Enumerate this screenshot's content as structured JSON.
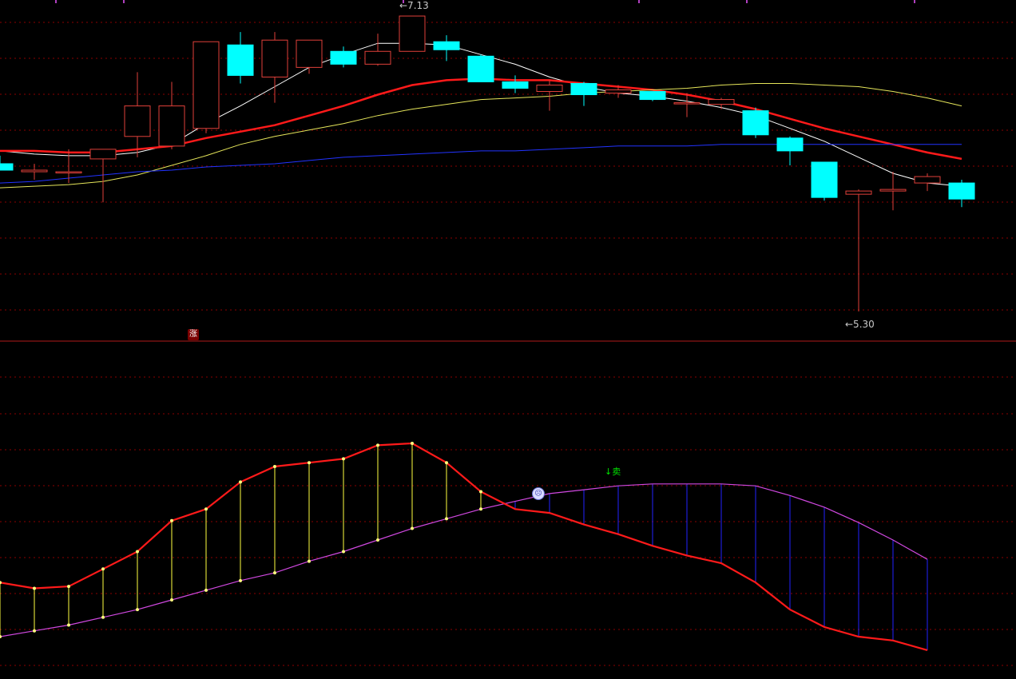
{
  "annotations": {
    "high_label": "←7.13",
    "low_label": "←5.30",
    "rise_badge": "涨",
    "sell_label": "↓卖",
    "face_icon": "face-icon"
  },
  "colors": {
    "background": "#000000",
    "grid": "#8b0000",
    "up_candle": "#e0403a",
    "down_candle": "#00ffff",
    "ma_white": "#ffffff",
    "ma_red": "#ff1a1a",
    "ma_yellow": "#e6e65a",
    "ma_blue": "#2233ff",
    "osc_fast": "#ff1a1a",
    "osc_slow": "#d048e0",
    "hist_pos": "#ffff40",
    "hist_neg": "#2222ff"
  },
  "chart_data": [
    {
      "type": "candlestick",
      "price_range": [
        5.15,
        7.2
      ],
      "grid": true,
      "candles": [
        {
          "o": 6.22,
          "h": 6.27,
          "l": 6.18,
          "c": 6.18
        },
        {
          "o": 6.17,
          "h": 6.22,
          "l": 6.12,
          "c": 6.18
        },
        {
          "o": 6.17,
          "h": 6.31,
          "l": 6.1,
          "c": 6.17
        },
        {
          "o": 6.25,
          "h": 6.31,
          "l": 5.98,
          "c": 6.31
        },
        {
          "o": 6.39,
          "h": 6.79,
          "l": 6.26,
          "c": 6.58
        },
        {
          "o": 6.33,
          "h": 6.73,
          "l": 6.31,
          "c": 6.58
        },
        {
          "o": 6.44,
          "h": 6.98,
          "l": 6.41,
          "c": 6.98
        },
        {
          "o": 6.96,
          "h": 7.04,
          "l": 6.72,
          "c": 6.77
        },
        {
          "o": 6.76,
          "h": 7.04,
          "l": 6.6,
          "c": 6.99
        },
        {
          "o": 6.82,
          "h": 6.98,
          "l": 6.78,
          "c": 6.99
        },
        {
          "o": 6.92,
          "h": 6.95,
          "l": 6.82,
          "c": 6.84
        },
        {
          "o": 6.84,
          "h": 7.03,
          "l": 6.83,
          "c": 6.92
        },
        {
          "o": 6.92,
          "h": 7.13,
          "l": 6.92,
          "c": 7.14
        },
        {
          "o": 6.98,
          "h": 7.02,
          "l": 6.86,
          "c": 6.93
        },
        {
          "o": 6.89,
          "h": 6.9,
          "l": 6.73,
          "c": 6.73
        },
        {
          "o": 6.73,
          "h": 6.77,
          "l": 6.66,
          "c": 6.69
        },
        {
          "o": 6.67,
          "h": 6.74,
          "l": 6.55,
          "c": 6.71
        },
        {
          "o": 6.72,
          "h": 6.73,
          "l": 6.58,
          "c": 6.65
        },
        {
          "o": 6.66,
          "h": 6.71,
          "l": 6.63,
          "c": 6.68
        },
        {
          "o": 6.67,
          "h": 6.67,
          "l": 6.61,
          "c": 6.62
        },
        {
          "o": 6.6,
          "h": 6.66,
          "l": 6.51,
          "c": 6.6
        },
        {
          "o": 6.59,
          "h": 6.63,
          "l": 6.56,
          "c": 6.62
        },
        {
          "o": 6.55,
          "h": 6.57,
          "l": 6.38,
          "c": 6.4
        },
        {
          "o": 6.38,
          "h": 6.39,
          "l": 6.21,
          "c": 6.3
        },
        {
          "o": 6.23,
          "h": 6.23,
          "l": 5.99,
          "c": 6.01
        },
        {
          "o": 6.03,
          "h": 6.06,
          "l": 5.3,
          "c": 6.05
        },
        {
          "o": 6.05,
          "h": 6.17,
          "l": 5.93,
          "c": 6.06
        },
        {
          "o": 6.1,
          "h": 6.16,
          "l": 6.05,
          "c": 6.14
        },
        {
          "o": 6.1,
          "h": 6.12,
          "l": 5.95,
          "c": 6.0
        }
      ],
      "moving_averages": [
        {
          "color": "white",
          "values": [
            6.3,
            6.28,
            6.27,
            6.27,
            6.29,
            6.34,
            6.47,
            6.58,
            6.7,
            6.82,
            6.9,
            6.97,
            6.97,
            6.96,
            6.9,
            6.84,
            6.76,
            6.7,
            6.66,
            6.64,
            6.61,
            6.57,
            6.52,
            6.44,
            6.36,
            6.26,
            6.16,
            6.1,
            6.08
          ]
        },
        {
          "color": "red",
          "values": [
            6.3,
            6.3,
            6.29,
            6.29,
            6.31,
            6.33,
            6.38,
            6.42,
            6.46,
            6.52,
            6.58,
            6.65,
            6.71,
            6.74,
            6.75,
            6.74,
            6.74,
            6.72,
            6.7,
            6.68,
            6.65,
            6.61,
            6.56,
            6.5,
            6.44,
            6.39,
            6.34,
            6.29,
            6.25
          ]
        },
        {
          "color": "yellow",
          "values": [
            6.07,
            6.08,
            6.09,
            6.11,
            6.15,
            6.21,
            6.27,
            6.34,
            6.39,
            6.43,
            6.47,
            6.52,
            6.56,
            6.59,
            6.62,
            6.63,
            6.64,
            6.66,
            6.67,
            6.68,
            6.69,
            6.71,
            6.72,
            6.72,
            6.71,
            6.7,
            6.67,
            6.63,
            6.58
          ]
        },
        {
          "color": "blue",
          "values": [
            6.1,
            6.11,
            6.13,
            6.15,
            6.17,
            6.18,
            6.2,
            6.21,
            6.22,
            6.24,
            6.26,
            6.27,
            6.28,
            6.29,
            6.3,
            6.3,
            6.31,
            6.32,
            6.33,
            6.33,
            6.33,
            6.34,
            6.34,
            6.34,
            6.34,
            6.34,
            6.34,
            6.34,
            6.34
          ]
        }
      ]
    },
    {
      "type": "line",
      "value_range": [
        0,
        100
      ],
      "grid": true,
      "series": [
        {
          "values": [
            28,
            25,
            26,
            35,
            44,
            60,
            66,
            80,
            88,
            90,
            92,
            99,
            100,
            90,
            75,
            66,
            64,
            58,
            53,
            47,
            42,
            38,
            28,
            14,
            5,
            0,
            -2,
            -7
          ]
        },
        {
          "values": [
            0,
            3,
            6,
            10,
            14,
            19,
            24,
            29,
            33,
            39,
            44,
            50,
            56,
            61,
            66,
            70,
            74,
            76,
            78,
            79,
            79,
            79,
            78,
            73,
            67,
            59,
            50,
            40
          ]
        }
      ]
    }
  ]
}
